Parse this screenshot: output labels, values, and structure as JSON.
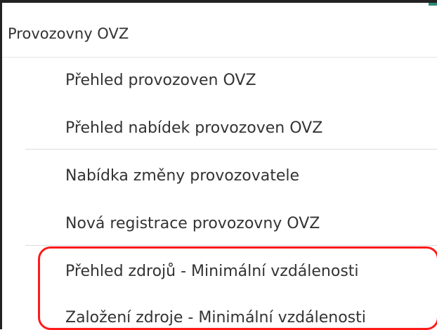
{
  "menu": {
    "header": "Provozovny OVZ",
    "items": [
      {
        "label": "Přehled provozoven OVZ"
      },
      {
        "label": "Přehled nabídek provozoven OVZ"
      },
      {
        "label": "Nabídka změny provozovatele"
      },
      {
        "label": "Nová registrace provozovny OVZ"
      },
      {
        "label": "Přehled zdrojů - Minimální vzdálenosti"
      },
      {
        "label": "Založení zdroje - Minimální vzdálenosti"
      }
    ]
  },
  "colors": {
    "highlight": "#ff1a1a",
    "accent": "#2e8b77",
    "text": "#333333"
  }
}
